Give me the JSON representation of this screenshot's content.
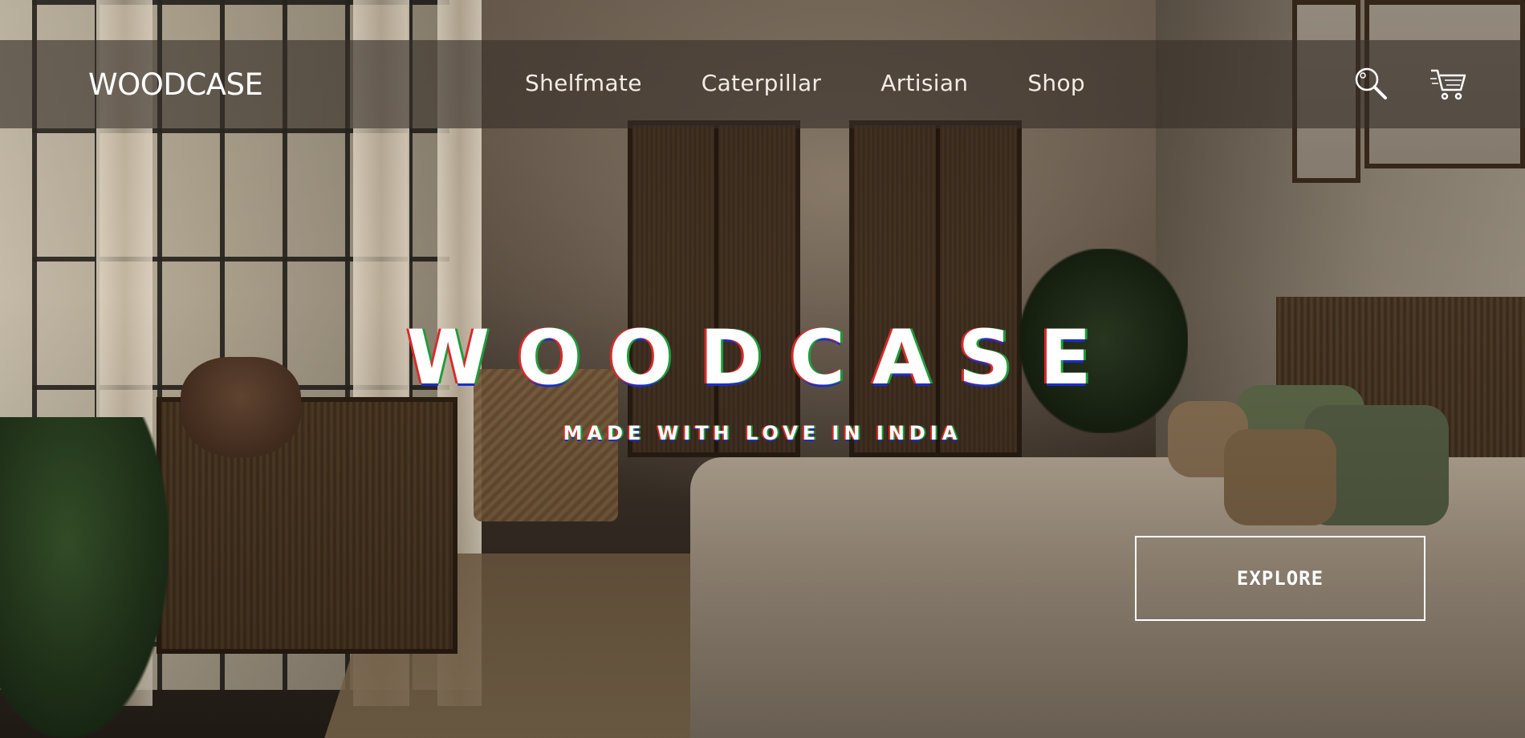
{
  "nav": {
    "logo": "WOODCASE",
    "links": [
      {
        "label": "Shelfmate"
      },
      {
        "label": "Caterpillar"
      },
      {
        "label": "Artisian"
      },
      {
        "label": "Shop"
      }
    ],
    "icons": {
      "search": "search-icon",
      "cart": "cart-icon"
    }
  },
  "hero": {
    "title": "WOODCASE",
    "subtitle": "MADE WITH LOVE IN INDIA",
    "cta_label": "EXPLORE"
  },
  "colors": {
    "nav_background": "#372f28",
    "text": "#ffffff",
    "glitch_red": "#d62b2b",
    "glitch_green": "#1f9c3b",
    "glitch_blue": "#1a2ecf"
  }
}
